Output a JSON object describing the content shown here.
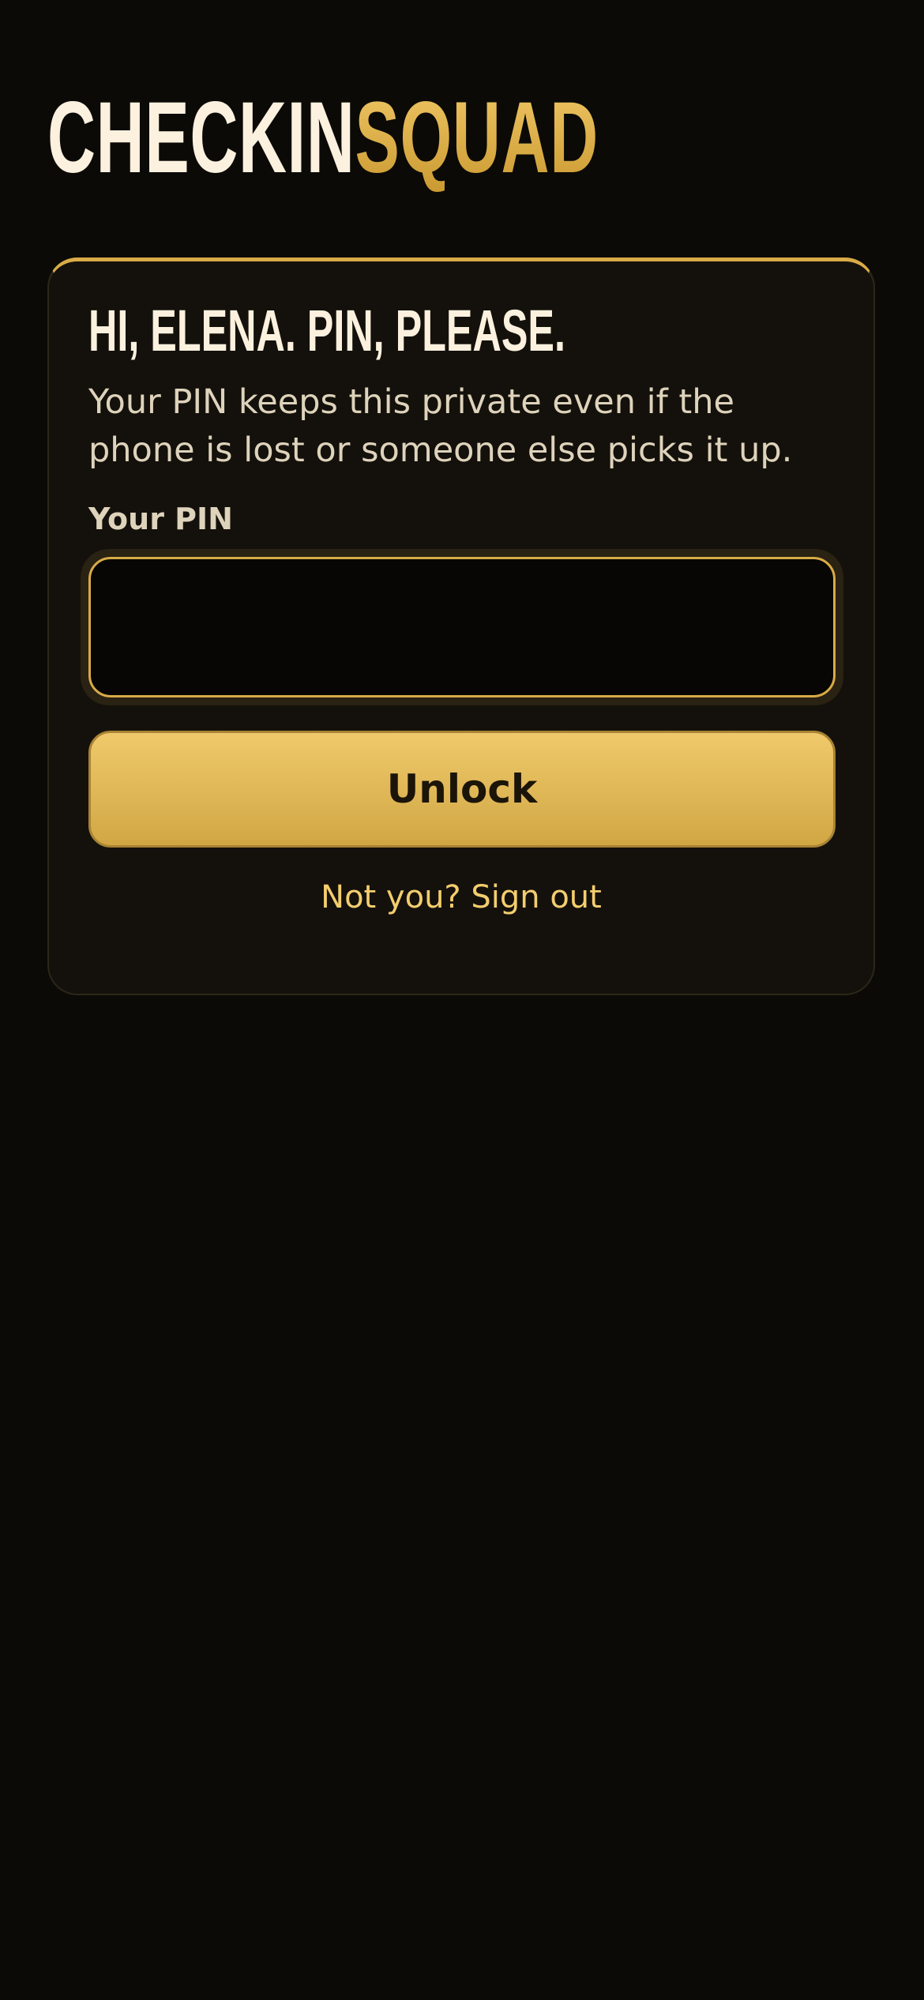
{
  "brand": {
    "logo_part_1": "CHECKIN",
    "logo_part_2": "SQUAD",
    "colors": {
      "background": "#0b0a07",
      "card": "#14110c",
      "accent_gold": "#d9ab47",
      "text_light": "#fbf1de",
      "text_muted": "#ded3bb",
      "link": "#f3cd6e"
    }
  },
  "pin_card": {
    "title": "HI, ELENA. PIN, PLEASE.",
    "subtitle": "Your PIN keeps this private even if the phone is lost or someone else picks it up.",
    "pin_label": "Your PIN",
    "pin_value": "",
    "pin_placeholder": "",
    "unlock_label": "Unlock",
    "signout_label": "Not you? Sign out"
  }
}
